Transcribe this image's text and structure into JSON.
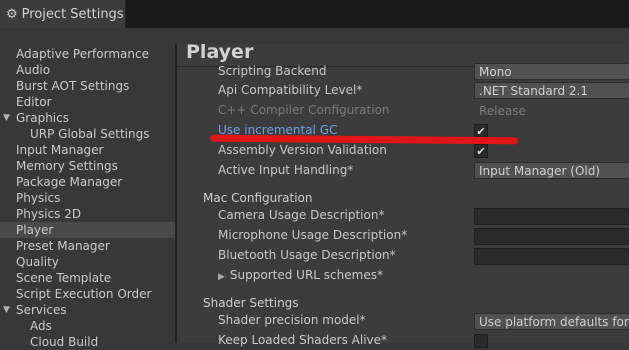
{
  "window": {
    "tab_title": "Project Settings",
    "tab_icon": "gear-icon"
  },
  "sidebar": {
    "items": [
      {
        "label": "Adaptive Performance"
      },
      {
        "label": "Audio"
      },
      {
        "label": "Burst AOT Settings"
      },
      {
        "label": "Editor"
      },
      {
        "label": "Graphics",
        "expanded": true
      },
      {
        "label": "URP Global Settings"
      },
      {
        "label": "Input Manager"
      },
      {
        "label": "Memory Settings"
      },
      {
        "label": "Package Manager"
      },
      {
        "label": "Physics"
      },
      {
        "label": "Physics 2D"
      },
      {
        "label": "Player",
        "selected": true
      },
      {
        "label": "Preset Manager"
      },
      {
        "label": "Quality"
      },
      {
        "label": "Scene Template"
      },
      {
        "label": "Script Execution Order"
      },
      {
        "label": "Services",
        "expanded": true
      },
      {
        "label": "Ads"
      },
      {
        "label": "Cloud Build"
      }
    ]
  },
  "main": {
    "title": "Player",
    "rows": {
      "scripting_backend": {
        "label": "Scripting Backend",
        "value": "Mono"
      },
      "api_level": {
        "label": "Api Compatibility Level*",
        "value": ".NET Standard 2.1"
      },
      "cpp_config": {
        "label": "C++ Compiler Configuration",
        "value": "Release"
      },
      "incremental_gc": {
        "label": "Use incremental GC",
        "checked": true
      },
      "assembly_validation": {
        "label": "Assembly Version Validation",
        "checked": true
      },
      "input_handling": {
        "label": "Active Input Handling*",
        "value": "Input Manager (Old)"
      }
    },
    "mac": {
      "heading": "Mac Configuration",
      "camera": "Camera Usage Description*",
      "microphone": "Microphone Usage Description*",
      "bluetooth": "Bluetooth Usage Description*",
      "url_schemes": "Supported URL schemes*"
    },
    "shader": {
      "heading": "Shader Settings",
      "precision_label": "Shader precision model*",
      "precision_value": "Use platform defaults for sampler",
      "keep_loaded": "Keep Loaded Shaders Alive*"
    }
  },
  "check_glyph": "✔",
  "annotation_color": "#e31616"
}
